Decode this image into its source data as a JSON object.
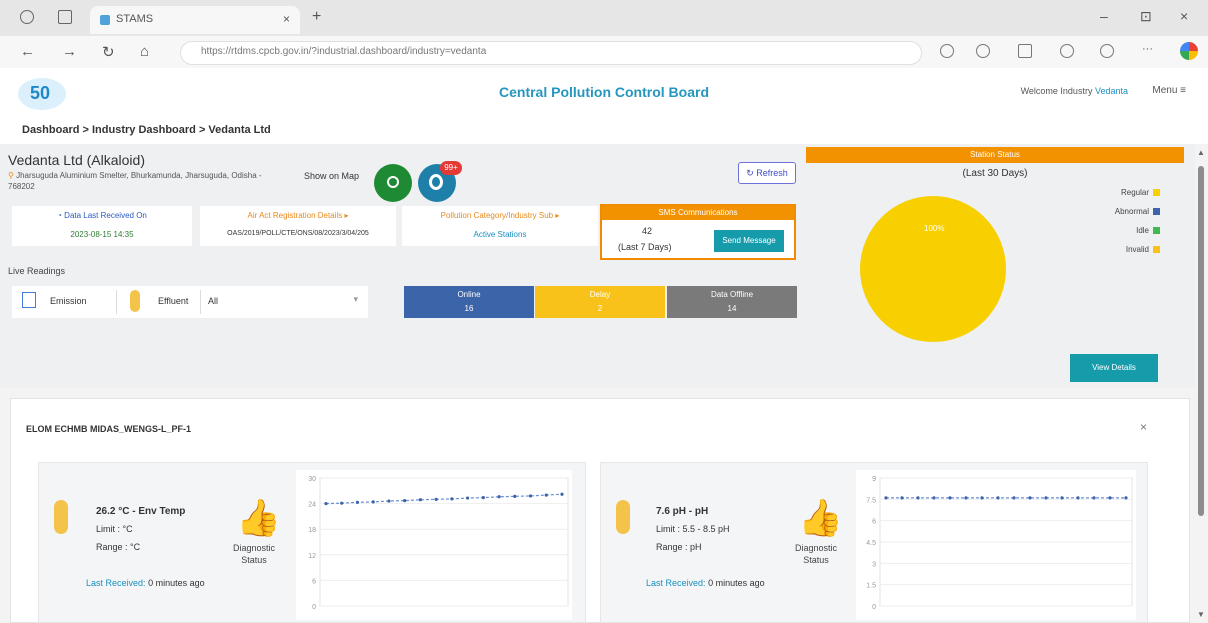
{
  "browser": {
    "tab_title": "STAMS",
    "url": "https://rtdms.cpcb.gov.in/?industrial.dashboard/industry=vedanta",
    "nav_back": "←",
    "nav_forward": "→",
    "nav_reload": "↻",
    "nav_home": "⌂",
    "new_tab": "+",
    "tab_close": "×",
    "win_min": "–",
    "win_max": "⊡",
    "win_close": "×",
    "more": "···"
  },
  "header": {
    "logo_text": "50",
    "title": "Central Pollution Control Board",
    "welcome_prefix": "Welcome Industry",
    "welcome_user": "Vedanta",
    "menu": "Menu ≡"
  },
  "breadcrumb": "Dashboard  >  Industry Dashboard  >  Vedanta Ltd",
  "industry": {
    "name": "Vedanta Ltd (Alkaloid)",
    "pin": "⚲",
    "address": "Jharsuguda Aluminium Smelter, Bhurkamunda, Jharsuguda, Odisha - 768202",
    "show_map": "Show on Map",
    "badge": "99+",
    "refresh": "↻ Refresh"
  },
  "cards": [
    {
      "l1": "◔ Data Last Received On",
      "l2": "2023-08-15 14:35"
    },
    {
      "l1": "Air Act Registration Details ▸",
      "l2": "OAS/2019/POLL/CTE/ONS/08/2023/3/04/205"
    },
    {
      "l1": "Pollution Category/Industry Sub ▸",
      "l2": "Active Stations"
    }
  ],
  "comms": {
    "header": "SMS Communications",
    "value": "42",
    "days": "(Last 7 Days)",
    "button": "Send Message"
  },
  "live": {
    "label": "Live Readings",
    "t1": "Emission",
    "t2": "Effluent",
    "select": "All",
    "caret": "▾"
  },
  "stats": [
    {
      "a": "Online",
      "b": "16",
      "color": "#3c64a8"
    },
    {
      "a": "Delay",
      "b": "2",
      "color": "#f8c21a"
    },
    {
      "a": "Data Offline",
      "b": "14",
      "color": "#7a7a7a"
    }
  ],
  "right": {
    "header": "Station Status",
    "days": "(Last 30 Days)",
    "pie_label": "100%",
    "legend": [
      {
        "label": "Regular",
        "color": "#f8cf00"
      },
      {
        "label": "Abnormal",
        "color": "#3c64a8"
      },
      {
        "label": "Idle",
        "color": "#3fb950"
      },
      {
        "label": "Invalid",
        "color": "#f8c21a"
      }
    ],
    "view_details": "View Details"
  },
  "station": {
    "title": "ELOM ECHMB MIDAS_WENGS-L_PF-1",
    "collapse": "×",
    "params": [
      {
        "value": "26.2 °C - Env Temp",
        "limit": "Limit : °C",
        "range": "Range : °C",
        "thumb": "👍",
        "diag": "Diagnostic Status",
        "last_label": "Last Received:",
        "last_ago": "0 minutes ago",
        "chart": {
          "ticks": [
            "30",
            "24",
            "18",
            "12",
            "6",
            "0"
          ],
          "ymax": 30,
          "values": [
            24.0,
            24.1,
            24.3,
            24.4,
            24.6,
            24.7,
            24.9,
            25.0,
            25.1,
            25.3,
            25.4,
            25.6,
            25.7,
            25.8,
            26.0,
            26.2
          ]
        }
      },
      {
        "value": "7.6 pH - pH",
        "limit": "Limit : 5.5 - 8.5 pH",
        "range": "Range : pH",
        "thumb": "👍",
        "diag": "Diagnostic Status",
        "last_label": "Last Received:",
        "last_ago": "0 minutes ago",
        "chart": {
          "ticks": [
            "9",
            "7.5",
            "6",
            "4.5",
            "3",
            "1.5",
            "0"
          ],
          "ymax": 9,
          "values": [
            7.6,
            7.6,
            7.6,
            7.6,
            7.6,
            7.6,
            7.6,
            7.6,
            7.6,
            7.6,
            7.6,
            7.6,
            7.6,
            7.6,
            7.6,
            7.6
          ]
        }
      }
    ]
  }
}
